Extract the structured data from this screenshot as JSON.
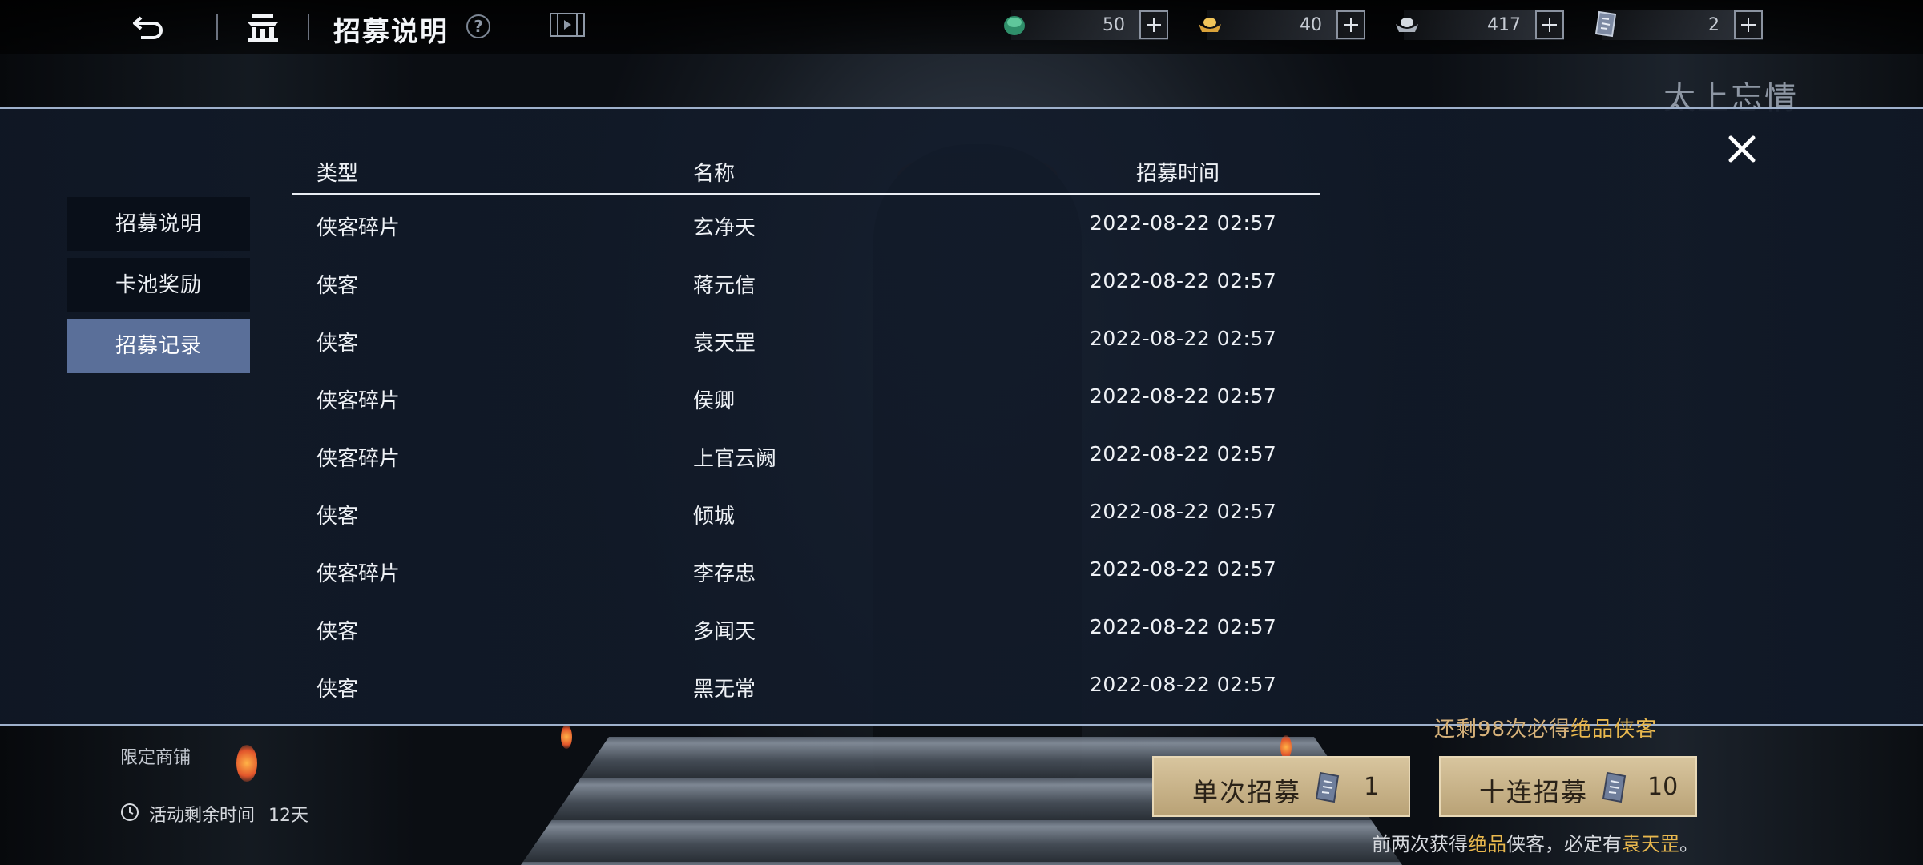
{
  "header": {
    "title": "招募说明",
    "help_icon": "help-icon",
    "currencies": [
      {
        "name": "jade",
        "icon": "jade-icon",
        "value": "50"
      },
      {
        "name": "gold",
        "icon": "gold-ingot-icon",
        "value": "40"
      },
      {
        "name": "silver",
        "icon": "silver-ingot-icon",
        "value": "417"
      },
      {
        "name": "token",
        "icon": "recruit-token-icon",
        "value": "2"
      }
    ]
  },
  "side_tabs": [
    {
      "label": "招募说明",
      "active": false
    },
    {
      "label": "卡池奖励",
      "active": false
    },
    {
      "label": "招募记录",
      "active": true
    }
  ],
  "table": {
    "headers": {
      "type": "类型",
      "name": "名称",
      "time": "招募时间"
    },
    "rows": [
      {
        "type": "侠客碎片",
        "name": "玄净天",
        "time": "2022-08-22 02:57"
      },
      {
        "type": "侠客",
        "name": "蒋元信",
        "time": "2022-08-22 02:57"
      },
      {
        "type": "侠客",
        "name": "袁天罡",
        "time": "2022-08-22 02:57"
      },
      {
        "type": "侠客碎片",
        "name": "侯卿",
        "time": "2022-08-22 02:57"
      },
      {
        "type": "侠客碎片",
        "name": "上官云阙",
        "time": "2022-08-22 02:57"
      },
      {
        "type": "侠客",
        "name": "倾城",
        "time": "2022-08-22 02:57"
      },
      {
        "type": "侠客碎片",
        "name": "李存忠",
        "time": "2022-08-22 02:57"
      },
      {
        "type": "侠客",
        "name": "多闻天",
        "time": "2022-08-22 02:57"
      },
      {
        "type": "侠客",
        "name": "黑无常",
        "time": "2022-08-22 02:57"
      }
    ]
  },
  "background": {
    "banner_title": "太上忘情"
  },
  "bottom": {
    "notice_prefix": "还剩98次必得",
    "notice_highlight": "绝品侠客",
    "single_pull": {
      "label": "单次招募",
      "cost": "1"
    },
    "ten_pull": {
      "label": "十连招募",
      "cost": "10"
    },
    "tip_prefix": "前两次获得",
    "tip_hl1": "绝品",
    "tip_mid": "侠客，必定有",
    "tip_hl2": "袁天罡",
    "tip_suffix": "。",
    "shop_label": "限定商铺",
    "activity_label": "活动剩余时间",
    "activity_value": "12天"
  },
  "colors": {
    "accent_tab": "#5a6f99",
    "gold_text": "#e9b84e",
    "button_fill": "#d8c59e"
  }
}
